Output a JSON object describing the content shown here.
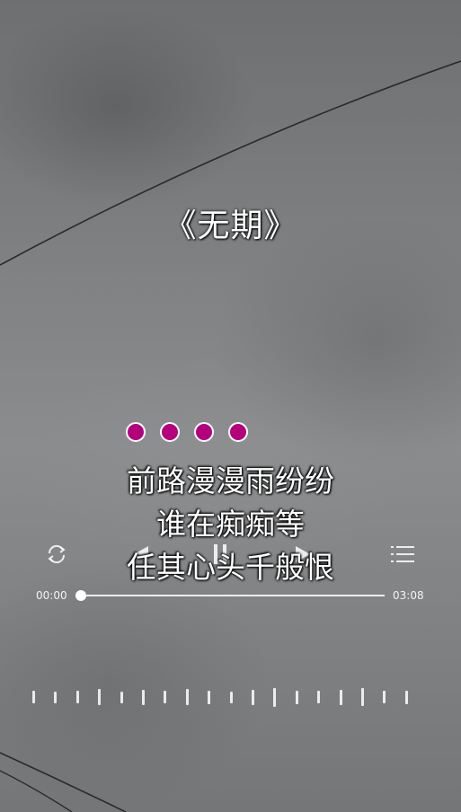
{
  "song": {
    "title": "《无期》"
  },
  "lyrics": {
    "lines": [
      "前路漫漫雨纷纷",
      "谁在痴痴等",
      "任其心头千般恨"
    ]
  },
  "indicator": {
    "dot_count": 4,
    "color": "#b4007c"
  },
  "player": {
    "repeat_icon": "repeat-icon",
    "prev_icon": "previous-icon",
    "pause_icon": "pause-icon",
    "next_icon": "next-icon",
    "playlist_icon": "playlist-icon",
    "current_time": "00:00",
    "total_time": "03:08",
    "progress": 0.0
  },
  "visualizer": {
    "levels": [
      0.5,
      0.45,
      0.5,
      0.65,
      0.45,
      0.6,
      0.5,
      0.65,
      0.55,
      0.45,
      0.6,
      0.75,
      0.55,
      0.5,
      0.6,
      0.7,
      0.5,
      0.55
    ]
  }
}
